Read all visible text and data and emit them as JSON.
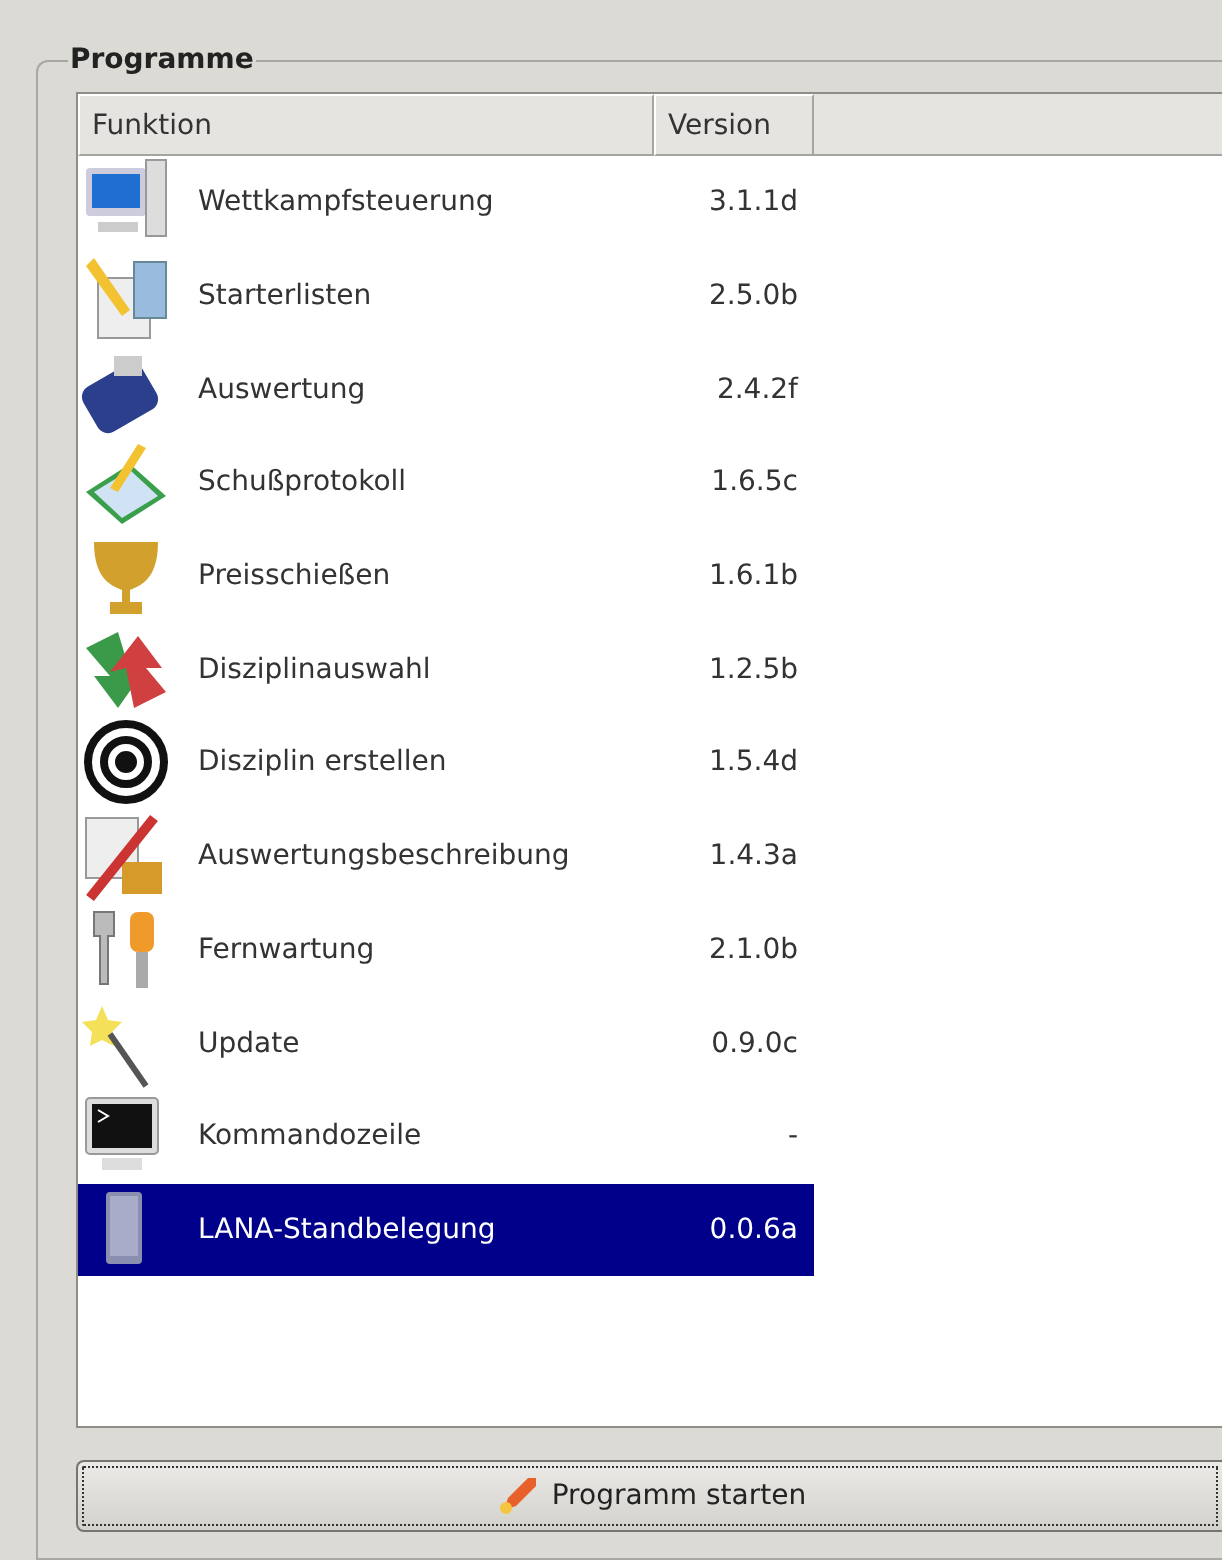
{
  "group": {
    "title": "Programme"
  },
  "table": {
    "columns": [
      "Funktion",
      "Version"
    ],
    "rows": [
      {
        "name": "Wettkampfsteuerung",
        "version": "3.1.1d",
        "selected": false
      },
      {
        "name": "Starterlisten",
        "version": "2.5.0b",
        "selected": false
      },
      {
        "name": "Auswertung",
        "version": "2.4.2f",
        "selected": false
      },
      {
        "name": "Schußprotokoll",
        "version": "1.6.5c",
        "selected": false
      },
      {
        "name": "Preisschießen",
        "version": "1.6.1b",
        "selected": false
      },
      {
        "name": "Disziplinauswahl",
        "version": "1.2.5b",
        "selected": false
      },
      {
        "name": "Disziplin erstellen",
        "version": "1.5.4d",
        "selected": false
      },
      {
        "name": "Auswertungsbeschreibung",
        "version": "1.4.3a",
        "selected": false
      },
      {
        "name": "Fernwartung",
        "version": "2.1.0b",
        "selected": false
      },
      {
        "name": "Update",
        "version": "0.9.0c",
        "selected": false
      },
      {
        "name": "Kommandozeile",
        "version": "-",
        "selected": false
      },
      {
        "name": "LANA-Standbelegung",
        "version": "0.0.6a",
        "selected": true
      }
    ]
  },
  "button": {
    "label": "Programm starten"
  }
}
